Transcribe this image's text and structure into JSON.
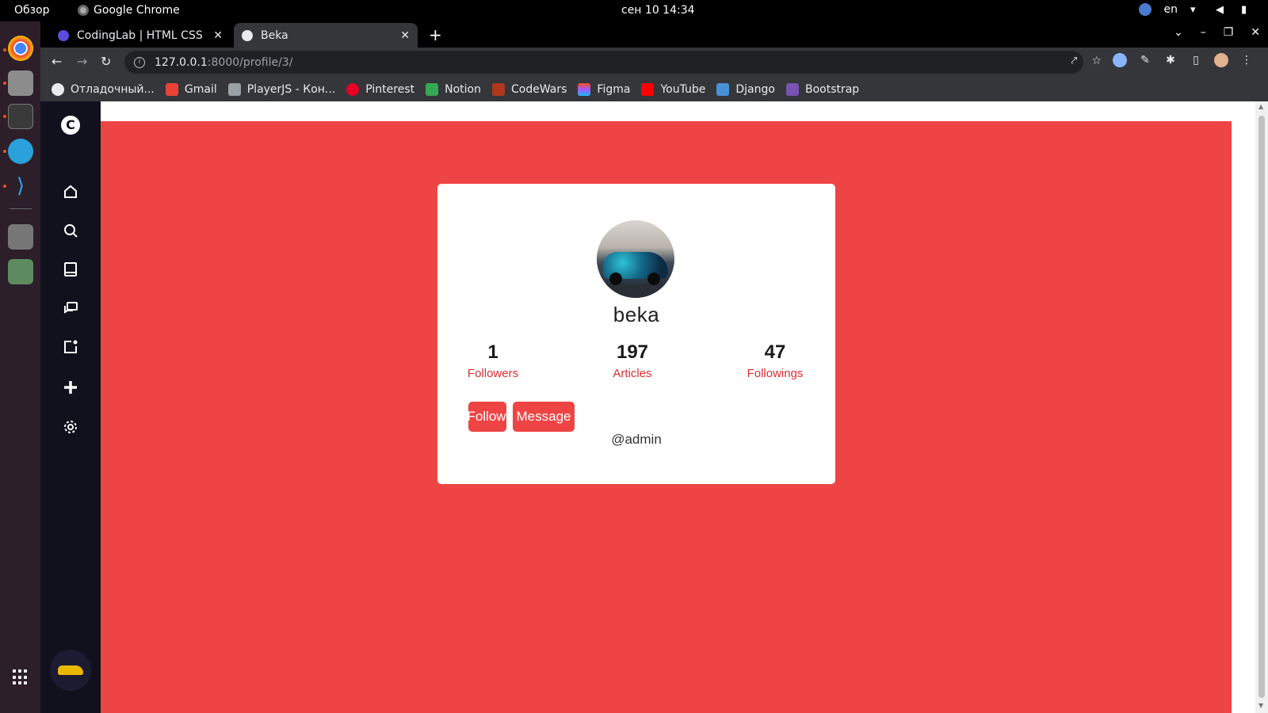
{
  "os": {
    "overview": "Обзор",
    "app_name": "Google Chrome",
    "clock": "сен 10  14:34",
    "lang": "en"
  },
  "browser": {
    "tabs": [
      {
        "title": "CodingLab | HTML CSS JavaScript",
        "active": false,
        "favicon_color": "#5b4ce0"
      },
      {
        "title": "Beka",
        "active": true,
        "favicon_color": "#e8eaed"
      }
    ],
    "url_host": "127.0.0.1",
    "url_path": ":8000/profile/3/",
    "bookmarks": [
      {
        "label": "Отладочный...",
        "color": "#e8eaed"
      },
      {
        "label": "Gmail",
        "color": "#ea4335"
      },
      {
        "label": "PlayerJS - Кон...",
        "color": "#9aa0a6"
      },
      {
        "label": "Pinterest",
        "color": "#e60023"
      },
      {
        "label": "Notion",
        "color": "#34a853"
      },
      {
        "label": "CodeWars",
        "color": "#b1361e"
      },
      {
        "label": "Figma",
        "color": "#f24e1e"
      },
      {
        "label": "YouTube",
        "color": "#ff0000"
      },
      {
        "label": "Django",
        "color": "#4a90d9"
      },
      {
        "label": "Bootstrap",
        "color": "#7952b3"
      }
    ]
  },
  "sidebar": {
    "logo": "C",
    "icons": [
      "home-icon",
      "search-icon",
      "tablet-icon",
      "chat-icon",
      "edit-icon",
      "plus-icon",
      "gear-icon"
    ]
  },
  "profile": {
    "username": "beka",
    "stats": [
      {
        "value": "1",
        "label": "Followers"
      },
      {
        "value": "197",
        "label": "Articles"
      },
      {
        "value": "47",
        "label": "Followings"
      }
    ],
    "follow_label": "Follow",
    "message_label": "Message",
    "handle": "@admin"
  },
  "colors": {
    "page_background": "#ef4444",
    "sidenav_background": "#11101d",
    "accent": "#ef4444"
  }
}
